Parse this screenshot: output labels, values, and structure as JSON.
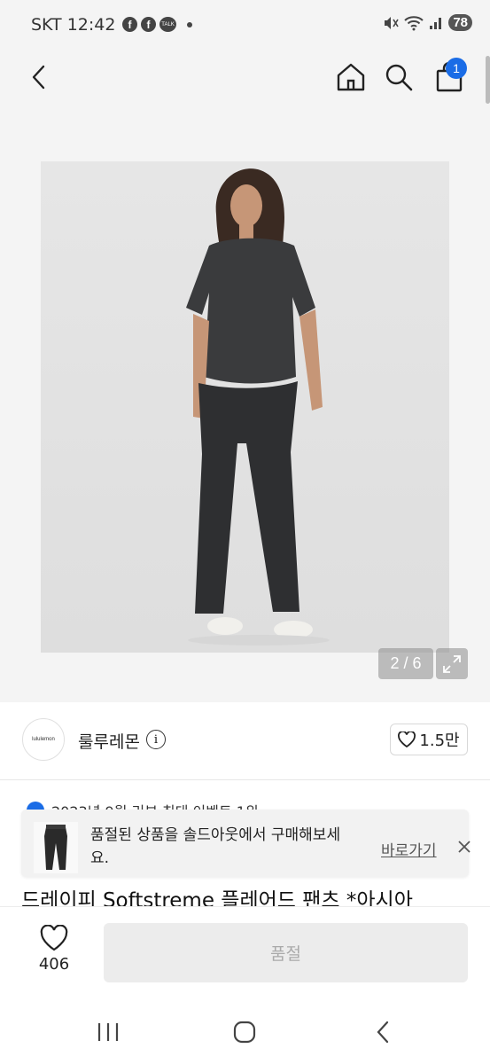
{
  "status_bar": {
    "carrier_time": "SKT 12:42",
    "icons_left": [
      "facebook-icon",
      "facebook-icon",
      "talk-icon",
      "dot-icon"
    ],
    "fb_label": "f",
    "talk_label": "TALK",
    "icons_right": [
      "mute-icon",
      "wifi-icon",
      "signal-icon"
    ],
    "battery": "78"
  },
  "header": {
    "icons": [
      "back-icon",
      "home-icon",
      "search-icon",
      "bag-icon"
    ],
    "cart_count": "1"
  },
  "gallery": {
    "counter": "2 / 6",
    "expand_icon": "expand-icon"
  },
  "store": {
    "logo_text": "lululemon",
    "name": "룰루레몬",
    "info_icon": "i",
    "follower_count": "1.5만"
  },
  "notice": {
    "text": "2023년 9월 리뷰 최대 이벤트 1위"
  },
  "toast": {
    "message": "품절된 상품을 솔드아웃에서 구매해보세요.",
    "link_label": "바로가기"
  },
  "product": {
    "title": "드레이피 Softstreme 플레어드 팬츠 *아시아"
  },
  "bottom_bar": {
    "like_count": "406",
    "soldout_label": "품절"
  },
  "colors": {
    "accent": "#1a6ce6",
    "background": "#f4f4f4",
    "disabled": "#ececec"
  }
}
